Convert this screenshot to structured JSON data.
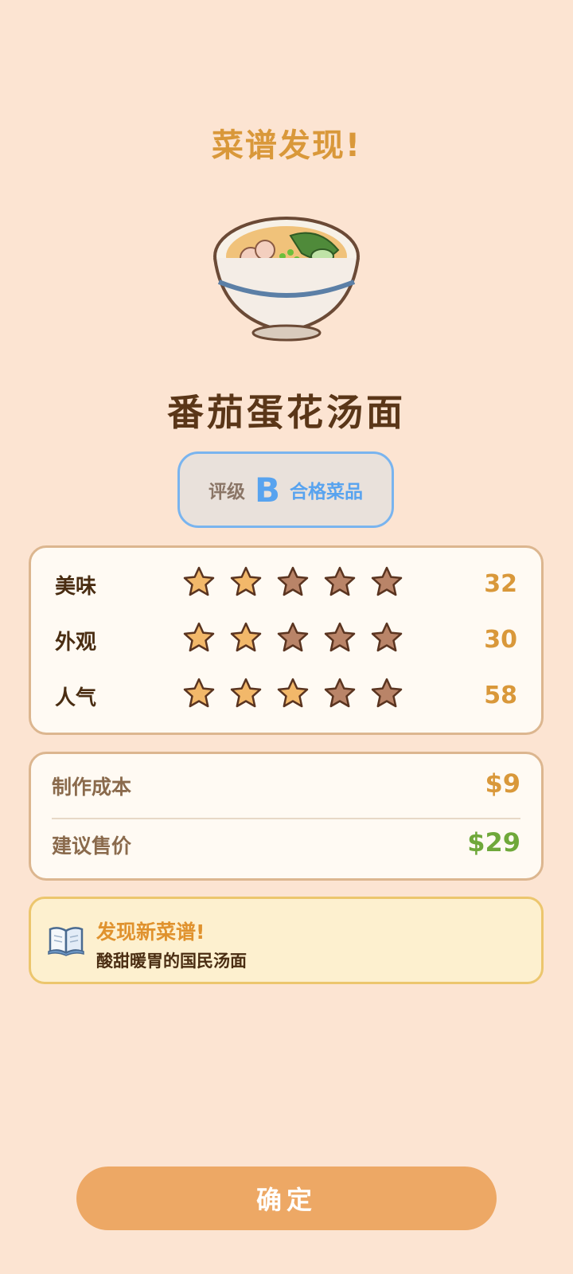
{
  "header": {
    "title": "菜谱发现!"
  },
  "dish": {
    "name": "番茄蛋花汤面",
    "image_icon": "noodle-bowl-icon"
  },
  "grade": {
    "prefix": "评级",
    "letter": "B",
    "description": "合格菜品",
    "color": "#58a3ef"
  },
  "stats": [
    {
      "label": "美味",
      "stars_filled": 2,
      "stars_total": 5,
      "value": "32"
    },
    {
      "label": "外观",
      "stars_filled": 2,
      "stars_total": 5,
      "value": "30"
    },
    {
      "label": "人气",
      "stars_filled": 3,
      "stars_total": 5,
      "value": "58"
    }
  ],
  "economics": {
    "cost_label": "制作成本",
    "cost_value": "$9",
    "cost_color": "#d9983a",
    "price_label": "建议售价",
    "price_value": "$29",
    "price_color": "#6fa83a"
  },
  "notice": {
    "icon": "open-book-icon",
    "title": "发现新菜谱!",
    "subtitle": "酸甜暖胃的国民汤面"
  },
  "actions": {
    "confirm_label": "确定"
  },
  "colors": {
    "background": "#fce4d2",
    "accent": "#d9983a",
    "star_filled": "#f2b86a",
    "star_empty": "#b98468"
  }
}
